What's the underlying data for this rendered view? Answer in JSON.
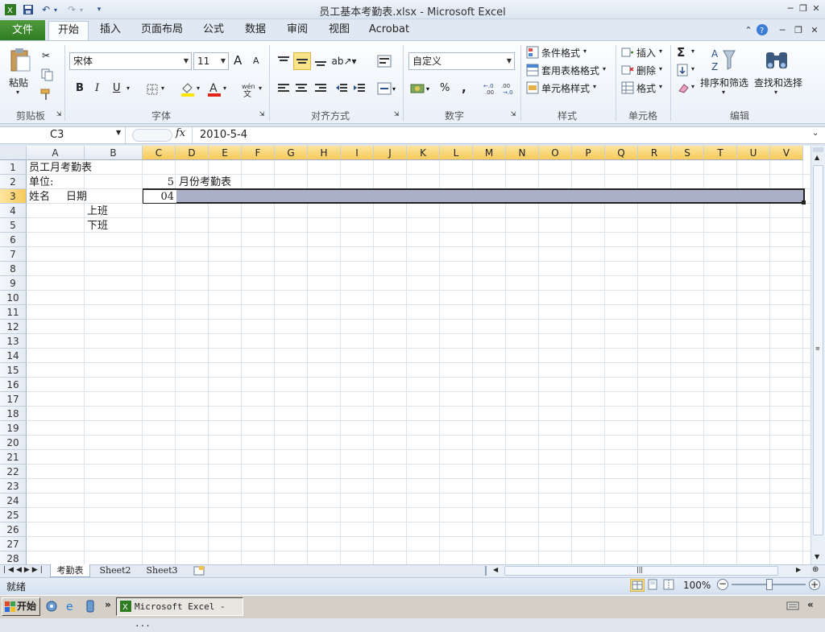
{
  "window": {
    "title": "员工基本考勤表.xlsx - Microsoft Excel",
    "minimize": "─",
    "restore": "❐",
    "close": "✕"
  },
  "ribbon_tabs": {
    "file": "文件",
    "items": [
      "开始",
      "插入",
      "页面布局",
      "公式",
      "数据",
      "审阅",
      "视图",
      "Acrobat"
    ],
    "active": "开始"
  },
  "groups": {
    "clipboard": {
      "label": "剪贴板",
      "paste": "粘贴"
    },
    "font": {
      "label": "字体",
      "font_name": "宋体",
      "font_size": "11",
      "bold": "B",
      "italic": "I",
      "underline": "U",
      "grow": "A",
      "shrink": "A"
    },
    "alignment": {
      "label": "对齐方式"
    },
    "number": {
      "label": "数字",
      "format": "自定义",
      "percent": "%",
      "comma": ","
    },
    "styles": {
      "label": "样式",
      "conditional": "条件格式",
      "table": "套用表格格式",
      "cell_styles": "单元格样式"
    },
    "cells": {
      "label": "单元格",
      "insert": "插入",
      "delete": "删除",
      "format": "格式"
    },
    "editing": {
      "label": "编辑",
      "sum": "Σ",
      "sort": "排序和筛选",
      "find": "查找和选择"
    }
  },
  "formula_bar": {
    "name_box": "C3",
    "fx": "fx",
    "value": "2010-5-4"
  },
  "sheet": {
    "columns": [
      "A",
      "B",
      "C",
      "D",
      "E",
      "F",
      "G",
      "H",
      "I",
      "J",
      "K",
      "L",
      "M",
      "N",
      "O",
      "P",
      "Q",
      "R",
      "S",
      "T",
      "U",
      "V"
    ],
    "rows": [
      "1",
      "2",
      "3",
      "4",
      "5",
      "6",
      "7",
      "8",
      "9",
      "10",
      "11",
      "12",
      "13",
      "14",
      "15",
      "16",
      "17",
      "18",
      "19",
      "20",
      "21",
      "22",
      "23",
      "24",
      "25",
      "26",
      "27",
      "28"
    ],
    "cells": {
      "A1": "员工月考勤表",
      "A2": "单位:",
      "C2_num": "5",
      "D2": "月份考勤表",
      "A3": "姓名",
      "A3b": "日期",
      "C3": "04",
      "B4": "上班",
      "B5": "下班"
    },
    "tabs": [
      "考勤表",
      "Sheet2",
      "Sheet3"
    ],
    "active_tab": "考勤表"
  },
  "status": {
    "ready": "就绪",
    "zoom": "100%"
  },
  "taskbar": {
    "start": "开始",
    "task_label": "Microsoft Excel - ..."
  },
  "colors": {
    "accent_green": "#2f7b22",
    "selected_header": "#f7ca5b",
    "selection_fill": "#aab0c8"
  }
}
